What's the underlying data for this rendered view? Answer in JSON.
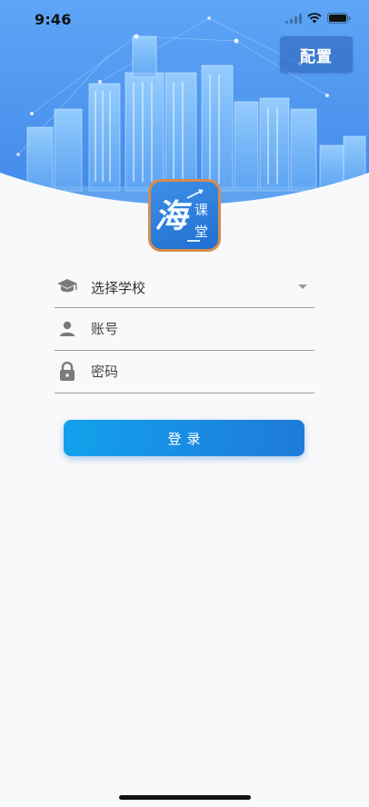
{
  "status_bar": {
    "time": "9:46",
    "icons": [
      "cellular-signal-icon",
      "wifi-icon",
      "battery-icon"
    ]
  },
  "header": {
    "config_label": "配置"
  },
  "logo": {
    "main_char": "海",
    "sub_chars": [
      "课",
      "堂"
    ]
  },
  "form": {
    "school_placeholder": "选择学校",
    "account_placeholder": "账号",
    "password_placeholder": "密码"
  },
  "actions": {
    "login_label": "登录"
  },
  "colors": {
    "accent": "#1f7ad8",
    "hero_blue": "#5aa8f5",
    "logo_border": "#d78c4e"
  }
}
